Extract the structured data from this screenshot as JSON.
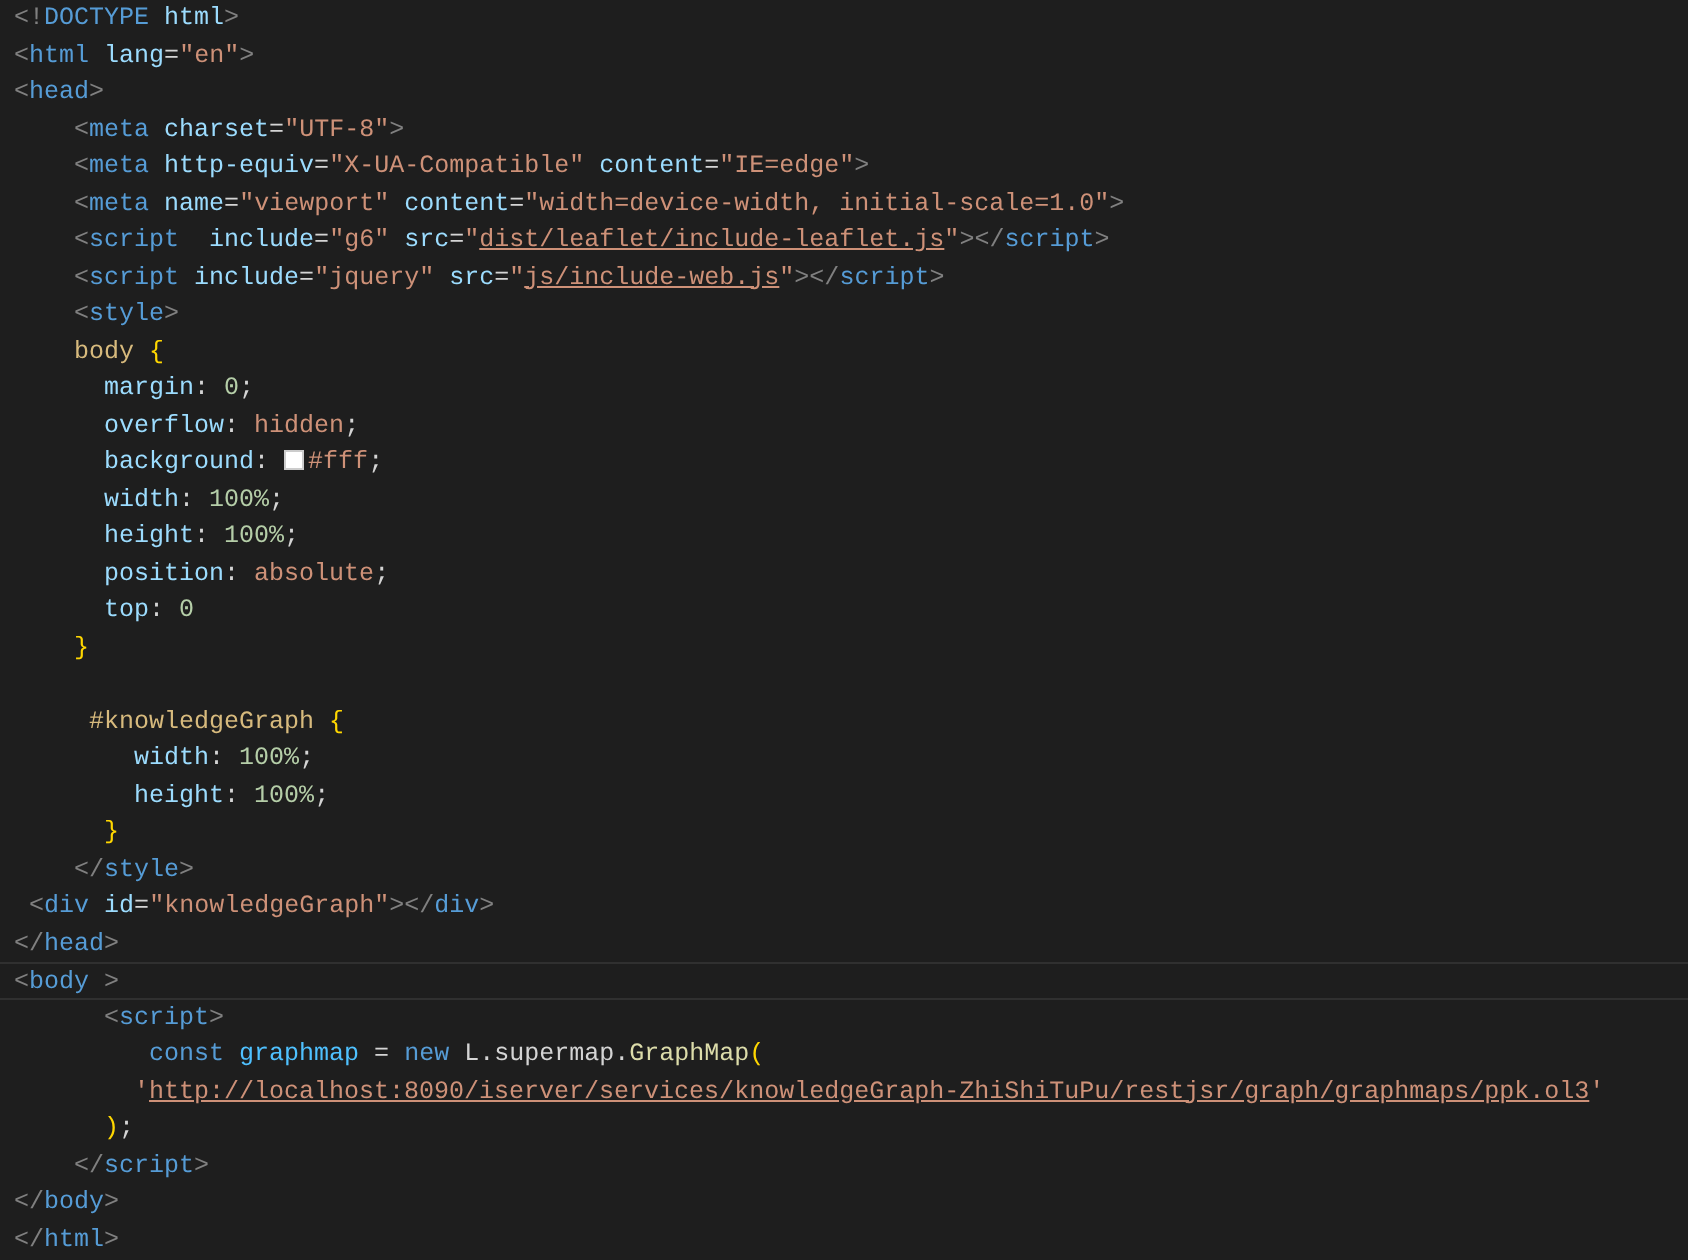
{
  "editor": {
    "lines": [
      {
        "current": false,
        "tokens": [
          {
            "kind": "punct",
            "text": "<!"
          },
          {
            "kind": "tag",
            "text": "DOCTYPE"
          },
          {
            "kind": "attr",
            "text": " html"
          },
          {
            "kind": "punct",
            "text": ">"
          }
        ]
      },
      {
        "current": false,
        "tokens": [
          {
            "kind": "punct",
            "text": "<"
          },
          {
            "kind": "tag",
            "text": "html"
          },
          {
            "kind": "attr",
            "text": " lang"
          },
          {
            "kind": "plain",
            "text": "="
          },
          {
            "kind": "str",
            "text": "\"en\""
          },
          {
            "kind": "punct",
            "text": ">"
          }
        ]
      },
      {
        "current": false,
        "tokens": [
          {
            "kind": "punct",
            "text": "<"
          },
          {
            "kind": "tag",
            "text": "head"
          },
          {
            "kind": "punct",
            "text": ">"
          }
        ]
      },
      {
        "current": false,
        "tokens": [
          {
            "kind": "punct",
            "text": "    <"
          },
          {
            "kind": "tag",
            "text": "meta"
          },
          {
            "kind": "attr",
            "text": " charset"
          },
          {
            "kind": "plain",
            "text": "="
          },
          {
            "kind": "str",
            "text": "\"UTF-8\""
          },
          {
            "kind": "punct",
            "text": ">"
          }
        ]
      },
      {
        "current": false,
        "tokens": [
          {
            "kind": "punct",
            "text": "    <"
          },
          {
            "kind": "tag",
            "text": "meta"
          },
          {
            "kind": "attr",
            "text": " http-equiv"
          },
          {
            "kind": "plain",
            "text": "="
          },
          {
            "kind": "str",
            "text": "\"X-UA-Compatible\""
          },
          {
            "kind": "attr",
            "text": " content"
          },
          {
            "kind": "plain",
            "text": "="
          },
          {
            "kind": "str",
            "text": "\"IE=edge\""
          },
          {
            "kind": "punct",
            "text": ">"
          }
        ]
      },
      {
        "current": false,
        "tokens": [
          {
            "kind": "punct",
            "text": "    <"
          },
          {
            "kind": "tag",
            "text": "meta"
          },
          {
            "kind": "attr",
            "text": " name"
          },
          {
            "kind": "plain",
            "text": "="
          },
          {
            "kind": "str",
            "text": "\"viewport\""
          },
          {
            "kind": "attr",
            "text": " content"
          },
          {
            "kind": "plain",
            "text": "="
          },
          {
            "kind": "str",
            "text": "\"width=device-width, initial-scale=1.0\""
          },
          {
            "kind": "punct",
            "text": ">"
          }
        ]
      },
      {
        "current": false,
        "tokens": [
          {
            "kind": "punct",
            "text": "    <"
          },
          {
            "kind": "tag",
            "text": "script"
          },
          {
            "kind": "attr",
            "text": "  include"
          },
          {
            "kind": "plain",
            "text": "="
          },
          {
            "kind": "str",
            "text": "\"g6\""
          },
          {
            "kind": "attr",
            "text": " src"
          },
          {
            "kind": "plain",
            "text": "="
          },
          {
            "kind": "str",
            "text": "\""
          },
          {
            "kind": "link",
            "text": "dist/leaflet/include-leaflet.js"
          },
          {
            "kind": "str",
            "text": "\""
          },
          {
            "kind": "punct",
            "text": "></"
          },
          {
            "kind": "tag",
            "text": "script"
          },
          {
            "kind": "punct",
            "text": ">"
          }
        ]
      },
      {
        "current": false,
        "tokens": [
          {
            "kind": "punct",
            "text": "    <"
          },
          {
            "kind": "tag",
            "text": "script"
          },
          {
            "kind": "attr",
            "text": " include"
          },
          {
            "kind": "plain",
            "text": "="
          },
          {
            "kind": "str",
            "text": "\"jquery\""
          },
          {
            "kind": "attr",
            "text": " src"
          },
          {
            "kind": "plain",
            "text": "="
          },
          {
            "kind": "str",
            "text": "\""
          },
          {
            "kind": "link",
            "text": "js/include-web.js"
          },
          {
            "kind": "str",
            "text": "\""
          },
          {
            "kind": "punct",
            "text": "></"
          },
          {
            "kind": "tag",
            "text": "script"
          },
          {
            "kind": "punct",
            "text": ">"
          }
        ]
      },
      {
        "current": false,
        "tokens": [
          {
            "kind": "punct",
            "text": "    <"
          },
          {
            "kind": "tag",
            "text": "style"
          },
          {
            "kind": "punct",
            "text": ">"
          }
        ]
      },
      {
        "current": false,
        "tokens": [
          {
            "kind": "sel",
            "text": "    body"
          },
          {
            "kind": "brace",
            "text": " {"
          }
        ]
      },
      {
        "current": false,
        "tokens": [
          {
            "kind": "prop",
            "text": "      margin"
          },
          {
            "kind": "plain",
            "text": ":"
          },
          {
            "kind": "num",
            "text": " 0"
          },
          {
            "kind": "plain",
            "text": ";"
          }
        ]
      },
      {
        "current": false,
        "tokens": [
          {
            "kind": "prop",
            "text": "      overflow"
          },
          {
            "kind": "plain",
            "text": ":"
          },
          {
            "kind": "val",
            "text": " hidden"
          },
          {
            "kind": "plain",
            "text": ";"
          }
        ]
      },
      {
        "current": false,
        "tokens": [
          {
            "kind": "prop",
            "text": "      background"
          },
          {
            "kind": "plain",
            "text": ": "
          },
          {
            "kind": "swatch",
            "color": "#ffffff"
          },
          {
            "kind": "val",
            "text": "#fff"
          },
          {
            "kind": "plain",
            "text": ";"
          }
        ]
      },
      {
        "current": false,
        "tokens": [
          {
            "kind": "prop",
            "text": "      width"
          },
          {
            "kind": "plain",
            "text": ":"
          },
          {
            "kind": "num",
            "text": " 100%"
          },
          {
            "kind": "plain",
            "text": ";"
          }
        ]
      },
      {
        "current": false,
        "tokens": [
          {
            "kind": "prop",
            "text": "      height"
          },
          {
            "kind": "plain",
            "text": ":"
          },
          {
            "kind": "num",
            "text": " 100%"
          },
          {
            "kind": "plain",
            "text": ";"
          }
        ]
      },
      {
        "current": false,
        "tokens": [
          {
            "kind": "prop",
            "text": "      position"
          },
          {
            "kind": "plain",
            "text": ":"
          },
          {
            "kind": "val",
            "text": " absolute"
          },
          {
            "kind": "plain",
            "text": ";"
          }
        ]
      },
      {
        "current": false,
        "tokens": [
          {
            "kind": "prop",
            "text": "      top"
          },
          {
            "kind": "plain",
            "text": ":"
          },
          {
            "kind": "num",
            "text": " 0"
          }
        ]
      },
      {
        "current": false,
        "tokens": [
          {
            "kind": "brace",
            "text": "    }"
          }
        ]
      },
      {
        "current": false
      },
      {
        "current": false,
        "tokens": [
          {
            "kind": "sel",
            "text": "     #knowledgeGraph"
          },
          {
            "kind": "brace",
            "text": " {"
          }
        ]
      },
      {
        "current": false,
        "tokens": [
          {
            "kind": "prop",
            "text": "        width"
          },
          {
            "kind": "plain",
            "text": ":"
          },
          {
            "kind": "num",
            "text": " 100%"
          },
          {
            "kind": "plain",
            "text": ";"
          }
        ]
      },
      {
        "current": false,
        "tokens": [
          {
            "kind": "prop",
            "text": "        height"
          },
          {
            "kind": "plain",
            "text": ":"
          },
          {
            "kind": "num",
            "text": " 100%"
          },
          {
            "kind": "plain",
            "text": ";"
          }
        ]
      },
      {
        "current": false,
        "tokens": [
          {
            "kind": "brace",
            "text": "      }"
          }
        ]
      },
      {
        "current": false,
        "tokens": [
          {
            "kind": "punct",
            "text": "    </"
          },
          {
            "kind": "tag",
            "text": "style"
          },
          {
            "kind": "punct",
            "text": ">"
          }
        ]
      },
      {
        "current": false,
        "tokens": [
          {
            "kind": "punct",
            "text": " <"
          },
          {
            "kind": "tag",
            "text": "div"
          },
          {
            "kind": "attr",
            "text": " id"
          },
          {
            "kind": "plain",
            "text": "="
          },
          {
            "kind": "str",
            "text": "\"knowledgeGraph\""
          },
          {
            "kind": "punct",
            "text": "></"
          },
          {
            "kind": "tag",
            "text": "div"
          },
          {
            "kind": "punct",
            "text": ">"
          }
        ]
      },
      {
        "current": false,
        "tokens": [
          {
            "kind": "punct",
            "text": "</"
          },
          {
            "kind": "tag",
            "text": "head"
          },
          {
            "kind": "punct",
            "text": ">"
          }
        ]
      },
      {
        "current": true,
        "tokens": [
          {
            "kind": "punct",
            "text": "<"
          },
          {
            "kind": "tag",
            "text": "body"
          },
          {
            "kind": "punct",
            "text": " >"
          }
        ]
      },
      {
        "current": false,
        "tokens": [
          {
            "kind": "punct",
            "text": "      <"
          },
          {
            "kind": "tag",
            "text": "script"
          },
          {
            "kind": "punct",
            "text": ">"
          }
        ]
      },
      {
        "current": false,
        "tokens": [
          {
            "kind": "kw",
            "text": "         const"
          },
          {
            "kind": "var",
            "text": " graphmap"
          },
          {
            "kind": "plain",
            "text": " = "
          },
          {
            "kind": "kw",
            "text": "new"
          },
          {
            "kind": "ident",
            "text": " L"
          },
          {
            "kind": "plain",
            "text": "."
          },
          {
            "kind": "ident",
            "text": "supermap"
          },
          {
            "kind": "plain",
            "text": "."
          },
          {
            "kind": "fn",
            "text": "GraphMap"
          },
          {
            "kind": "brace",
            "text": "("
          }
        ]
      },
      {
        "current": false,
        "tokens": [
          {
            "kind": "str",
            "text": "        '"
          },
          {
            "kind": "link",
            "text": "http://localhost:8090/iserver/services/knowledgeGraph-ZhiShiTuPu/restjsr/graph/graphmaps/ppk.ol3"
          },
          {
            "kind": "str",
            "text": "'"
          }
        ]
      },
      {
        "current": false,
        "tokens": [
          {
            "kind": "brace",
            "text": "      )"
          },
          {
            "kind": "plain",
            "text": ";"
          }
        ]
      },
      {
        "current": false,
        "tokens": [
          {
            "kind": "punct",
            "text": "    </"
          },
          {
            "kind": "tag",
            "text": "script"
          },
          {
            "kind": "punct",
            "text": ">"
          }
        ]
      },
      {
        "current": false,
        "tokens": [
          {
            "kind": "punct",
            "text": "</"
          },
          {
            "kind": "tag",
            "text": "body"
          },
          {
            "kind": "punct",
            "text": ">"
          }
        ]
      },
      {
        "current": false,
        "tokens": [
          {
            "kind": "punct",
            "text": "</"
          },
          {
            "kind": "tag",
            "text": "html"
          },
          {
            "kind": "punct",
            "text": ">"
          }
        ]
      }
    ]
  }
}
